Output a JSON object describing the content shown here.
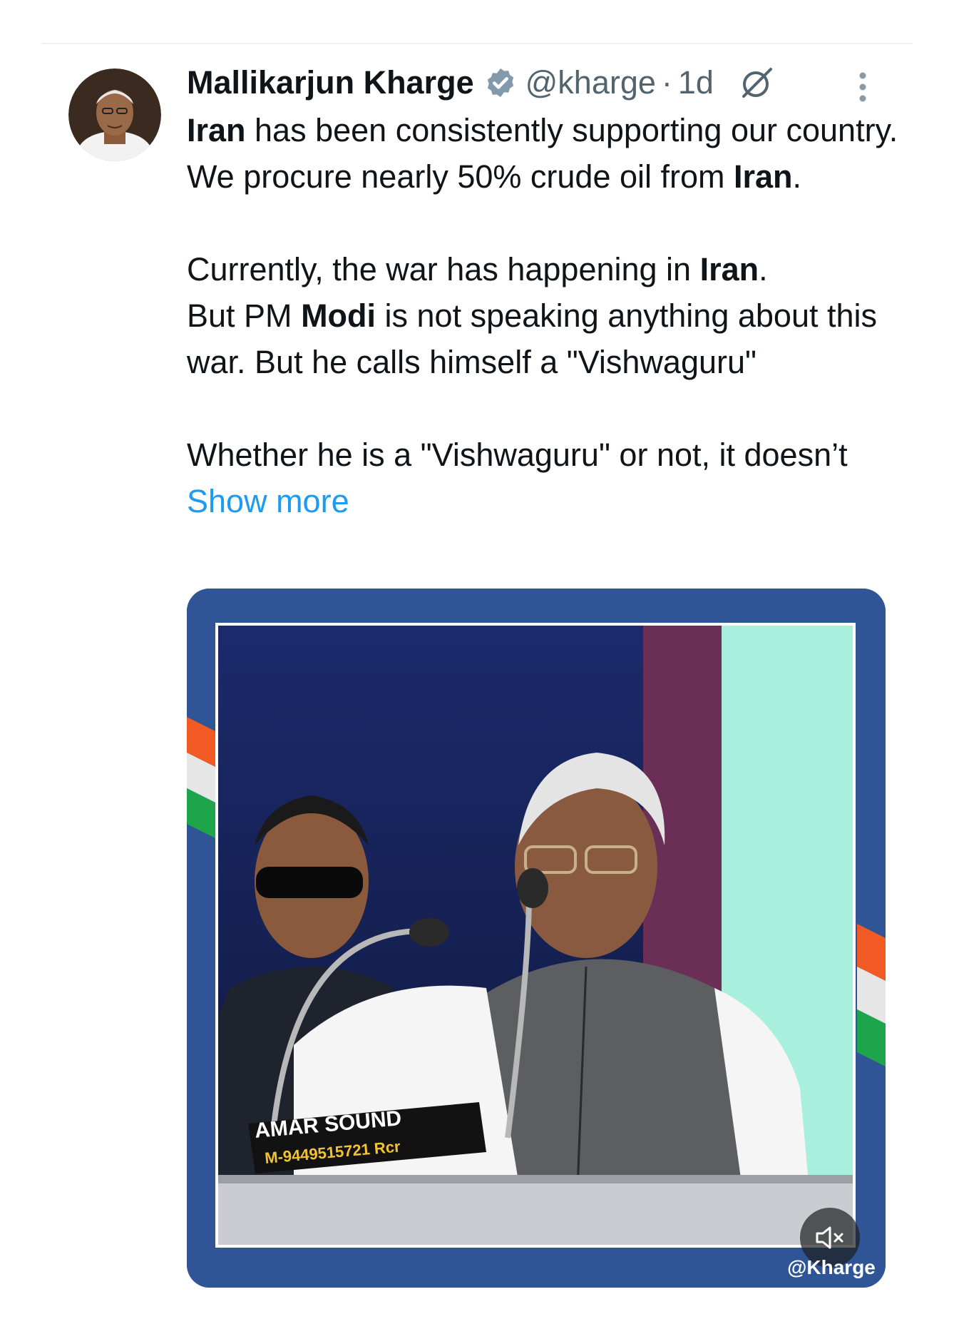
{
  "tweet": {
    "author_name": "Mallikarjun Kharge",
    "handle": "@kharge",
    "separator": "·",
    "time": "1d",
    "paragraph1": {
      "part1": "Iran",
      "part2": " has been consistently supporting our country. We procure nearly 50% crude oil from ",
      "part3": "Iran",
      "part4": "."
    },
    "paragraph2": {
      "part1": "Currently, the war has happening in ",
      "part2": "Iran",
      "part3": ".",
      "part4": "But PM ",
      "part5": "Modi",
      "part6": " is not speaking anything about this war. But he calls himself a \"Vishwaguru\""
    },
    "paragraph3": {
      "part1": "Whether he is a \"Vishwaguru\" or not, it doesn’t ",
      "show_more": "Show more"
    }
  },
  "media": {
    "podium_sign_line1": "AMAR SOUND",
    "podium_sign_line2": "M-9449515721 Rcr",
    "watermark": "@Kharge",
    "mute_icon": "speaker-muted-icon"
  },
  "colors": {
    "frame_blue": "#2f5597",
    "saffron": "#f15a22",
    "green": "#1ea44b",
    "link_blue": "#1d9bf0",
    "verified_gray": "#829aab"
  }
}
